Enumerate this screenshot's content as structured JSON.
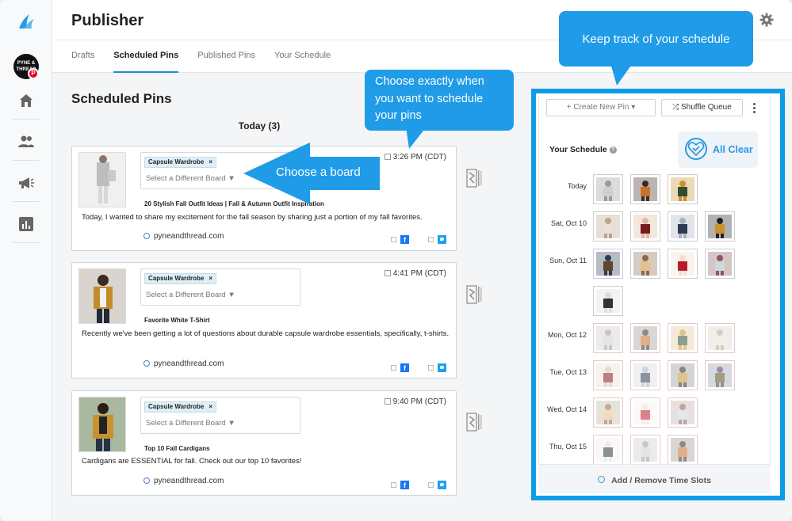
{
  "app": {
    "title": "Publisher"
  },
  "rail": {
    "avatar_text": "PYNE & THREAD",
    "badge": "P",
    "colors": {
      "accent": "#1f9be8",
      "pinterest": "#e60023"
    }
  },
  "tabs": [
    {
      "label": "Drafts"
    },
    {
      "label": "Scheduled Pins",
      "active": true
    },
    {
      "label": "Published Pins"
    },
    {
      "label": "Your Schedule"
    }
  ],
  "main": {
    "title": "Scheduled Pins",
    "day_header": "Today (3)",
    "cards": [
      {
        "board_chip": "Capsule Wardrobe",
        "chip_remove": "×",
        "board_placeholder": "Select a Different Board ▼",
        "time": "3:26 PM (CDT)",
        "pin_title": "20 Stylish Fall Outfit Ideas | Fall & Autumn Outfit Inspiration",
        "description": "Today, I wanted to share my excitement for the fall season by sharing just a portion of my fall favorites.",
        "domain": "pyneandthread.com",
        "fb": "f"
      },
      {
        "board_chip": "Capsule Wardrobe",
        "chip_remove": "×",
        "board_placeholder": "Select a Different Board ▼",
        "time": "4:41 PM (CDT)",
        "pin_title": "Favorite White T-Shirt",
        "description": "Recently we've been getting a lot of questions about durable capsule wardrobe essentials, specifically, t-shirts.",
        "domain": "pyneandthread.com",
        "fb": "f"
      },
      {
        "board_chip": "Capsule Wardrobe",
        "chip_remove": "×",
        "board_placeholder": "Select a Different Board ▼",
        "time": "9:40 PM (CDT)",
        "pin_title": "Top 10 Fall Cardigans",
        "description": "Cardigans are ESSENTIAL for fall. Check out our top 10 favorites!",
        "domain": "pyneandthread.com",
        "fb": "f"
      }
    ]
  },
  "callouts": {
    "keep_track": "Keep track of your schedule",
    "choose_when": "Choose exactly when you want to schedule your pins",
    "choose_board": "Choose a board"
  },
  "schedule": {
    "create_btn": "+ Create New Pin ▾",
    "shuffle_btn": "⤮ Shuffle Queue",
    "title": "Your Schedule",
    "help": "?",
    "all_clear": "All Clear",
    "add_remove": "Add / Remove Time Slots",
    "days": [
      {
        "label": "Today",
        "slots": 3,
        "filled": 3
      },
      {
        "label": "Sat, Oct 10",
        "slots": 4,
        "filled": 4
      },
      {
        "label": "Sun, Oct 11",
        "slots": 5,
        "filled": 5
      },
      {
        "label": "Mon, Oct 12",
        "slots": 4,
        "filled": 0
      },
      {
        "label": "Tue, Oct 13",
        "slots": 4,
        "filled": 0
      },
      {
        "label": "Wed, Oct 14",
        "slots": 3,
        "filled": 0
      },
      {
        "label": "Thu, Oct 15",
        "slots": 3,
        "filled": 0
      }
    ]
  }
}
